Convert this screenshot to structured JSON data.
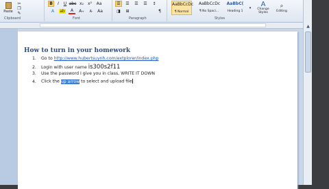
{
  "ribbon": {
    "clipboard": {
      "paste": "Paste",
      "group": "Clipboard"
    },
    "font": {
      "group": "Font"
    },
    "paragraph": {
      "group": "Paragraph"
    },
    "styles": {
      "group": "Styles",
      "items": [
        {
          "sample": "AaBbCcDc",
          "name": "¶ Normal"
        },
        {
          "sample": "AaBbCcDc",
          "name": "¶ No Spaci..."
        },
        {
          "sample": "AaBbC(",
          "name": "Heading 1"
        }
      ],
      "change_styles": "Change Styles",
      "editing": "Editing"
    }
  },
  "document": {
    "heading": "How to turn in your homework",
    "items": [
      {
        "num": "1.",
        "pre": "Go to ",
        "link": "http://www.hubertsuynh.com/extplorer/index.php"
      },
      {
        "num": "2.",
        "pre": "Login with user name ",
        "big": "is300s2f11"
      },
      {
        "num": "3.",
        "pre": "Use the password I give you in class, WRITE IT DOWN"
      },
      {
        "num": "4.",
        "pre": "Click the ",
        "selected": "up arrow",
        "post": " to select and upload file"
      }
    ]
  }
}
